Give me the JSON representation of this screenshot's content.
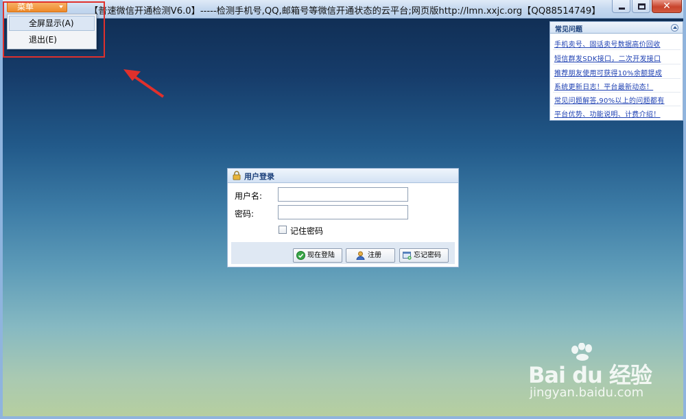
{
  "titlebar": {
    "menu_label": "菜单",
    "title": "【普速微信开通检测V6.0】-----检测手机号,QQ,邮箱号等微信开通状态的云平台;网页版http://lmn.xxjc.org【QQ88514749】"
  },
  "menu": {
    "items": [
      {
        "label": "全屏显示(A)",
        "highlighted": true
      },
      {
        "label": "退出(E)",
        "highlighted": false
      }
    ]
  },
  "faq": {
    "title": "常见问题",
    "items": [
      "手机卖号、固话卖号数据高价回收",
      "短信群发SDK接口，二次开发接口",
      "推荐朋友使用可获得10%余额提成",
      "系统更新日志！平台最新动态！",
      "常见问题解答,90%以上的问题都有",
      "平台优势、功能说明、计费介绍！"
    ]
  },
  "login": {
    "title": "用户登录",
    "username_label": "用户名:",
    "password_label": "密码:",
    "username_value": "",
    "password_value": "",
    "remember_label": "记住密码",
    "remember_checked": false,
    "buttons": {
      "login": "现在登陆",
      "register": "注册",
      "forgot": "忘记密码"
    }
  },
  "watermark": {
    "brand": "Bai du 经验",
    "url": "jingyan.baidu.com"
  },
  "colors": {
    "annotation": "#e0302c",
    "menu_button": "#ee8a2a",
    "link": "#1c3fb2"
  }
}
